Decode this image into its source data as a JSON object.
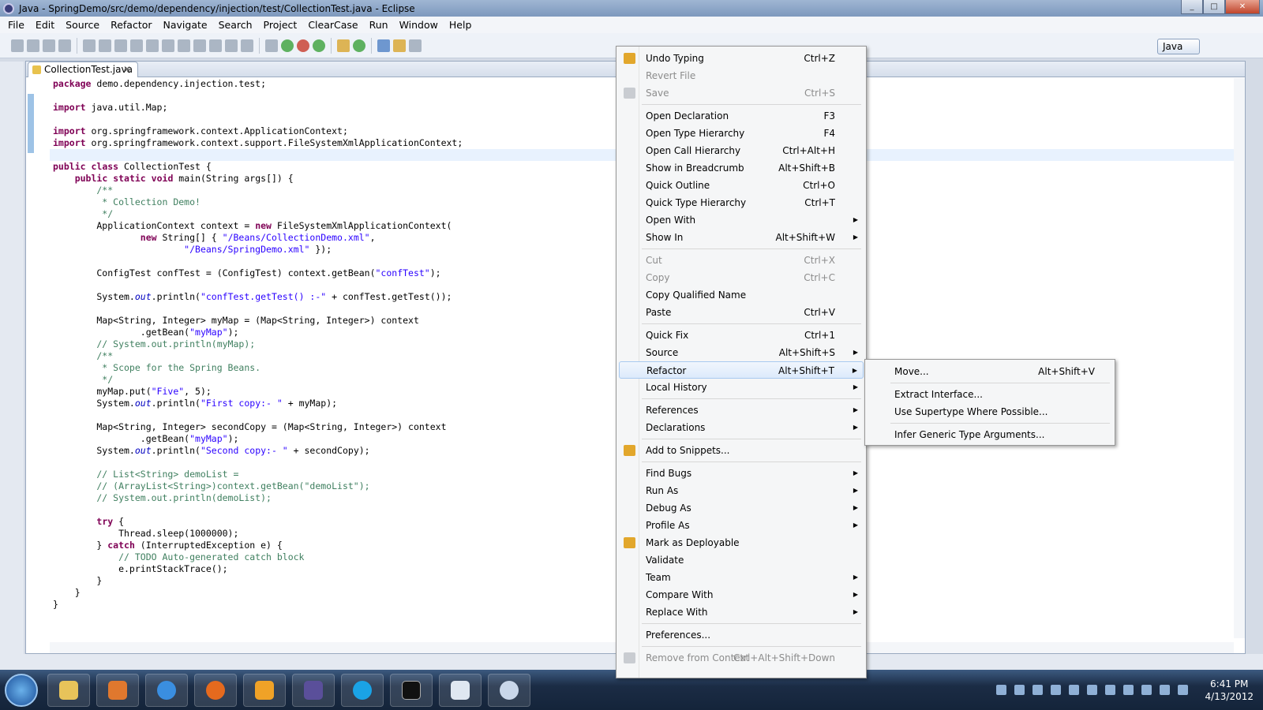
{
  "window": {
    "title": "Java - SpringDemo/src/demo/dependency/injection/test/CollectionTest.java - Eclipse"
  },
  "menubar": [
    "File",
    "Edit",
    "Source",
    "Refactor",
    "Navigate",
    "Search",
    "Project",
    "ClearCase",
    "Run",
    "Window",
    "Help"
  ],
  "perspective": {
    "label": "Java"
  },
  "editor": {
    "tab_label": "CollectionTest.java",
    "code_lines": [
      "package demo.dependency.injection.test;",
      "",
      "import java.util.Map;",
      "",
      "import org.springframework.context.ApplicationContext;",
      "import org.springframework.context.support.FileSystemXmlApplicationContext;",
      "",
      "public class CollectionTest {",
      "    public static void main(String args[]) {",
      "        /**",
      "         * Collection Demo!",
      "         */",
      "        ApplicationContext context = new FileSystemXmlApplicationContext(",
      "                new String[] { \"/Beans/CollectionDemo.xml\",",
      "                        \"/Beans/SpringDemo.xml\" });",
      "",
      "        ConfigTest confTest = (ConfigTest) context.getBean(\"confTest\");",
      "",
      "        System.out.println(\"confTest.getTest() :-\" + confTest.getTest());",
      "",
      "        Map<String, Integer> myMap = (Map<String, Integer>) context",
      "                .getBean(\"myMap\");",
      "        // System.out.println(myMap);",
      "        /**",
      "         * Scope for the Spring Beans.",
      "         */",
      "        myMap.put(\"Five\", 5);",
      "        System.out.println(\"First copy:- \" + myMap);",
      "",
      "        Map<String, Integer> secondCopy = (Map<String, Integer>) context",
      "                .getBean(\"myMap\");",
      "        System.out.println(\"Second copy:- \" + secondCopy);",
      "",
      "        // List<String> demoList =",
      "        // (ArrayList<String>)context.getBean(\"demoList\");",
      "        // System.out.println(demoList);",
      "",
      "        try {",
      "            Thread.sleep(1000000);",
      "        } catch (InterruptedException e) {",
      "            // TODO Auto-generated catch block",
      "            e.printStackTrace();",
      "        }",
      "    }",
      "}"
    ]
  },
  "context_menu": [
    {
      "label": "Undo Typing",
      "shortcut": "Ctrl+Z",
      "icon": "undo-icon"
    },
    {
      "label": "Revert File",
      "disabled": true
    },
    {
      "label": "Save",
      "shortcut": "Ctrl+S",
      "disabled": true,
      "icon": "save-icon"
    },
    {
      "sep": true
    },
    {
      "label": "Open Declaration",
      "shortcut": "F3"
    },
    {
      "label": "Open Type Hierarchy",
      "shortcut": "F4"
    },
    {
      "label": "Open Call Hierarchy",
      "shortcut": "Ctrl+Alt+H"
    },
    {
      "label": "Show in Breadcrumb",
      "shortcut": "Alt+Shift+B"
    },
    {
      "label": "Quick Outline",
      "shortcut": "Ctrl+O"
    },
    {
      "label": "Quick Type Hierarchy",
      "shortcut": "Ctrl+T"
    },
    {
      "label": "Open With",
      "submenu": true
    },
    {
      "label": "Show In",
      "shortcut": "Alt+Shift+W",
      "submenu": true
    },
    {
      "sep": true
    },
    {
      "label": "Cut",
      "shortcut": "Ctrl+X",
      "disabled": true
    },
    {
      "label": "Copy",
      "shortcut": "Ctrl+C",
      "disabled": true
    },
    {
      "label": "Copy Qualified Name"
    },
    {
      "label": "Paste",
      "shortcut": "Ctrl+V"
    },
    {
      "sep": true
    },
    {
      "label": "Quick Fix",
      "shortcut": "Ctrl+1"
    },
    {
      "label": "Source",
      "shortcut": "Alt+Shift+S",
      "submenu": true
    },
    {
      "label": "Refactor",
      "shortcut": "Alt+Shift+T",
      "submenu": true,
      "highlighted": true
    },
    {
      "label": "Local History",
      "submenu": true
    },
    {
      "sep": true
    },
    {
      "label": "References",
      "submenu": true
    },
    {
      "label": "Declarations",
      "submenu": true
    },
    {
      "sep": true
    },
    {
      "label": "Add to Snippets...",
      "icon": "snippet-icon"
    },
    {
      "sep": true
    },
    {
      "label": "Find Bugs",
      "submenu": true
    },
    {
      "label": "Run As",
      "submenu": true
    },
    {
      "label": "Debug As",
      "submenu": true
    },
    {
      "label": "Profile As",
      "submenu": true
    },
    {
      "label": "Mark as Deployable",
      "icon": "deploy-icon"
    },
    {
      "label": "Validate"
    },
    {
      "label": "Team",
      "submenu": true
    },
    {
      "label": "Compare With",
      "submenu": true
    },
    {
      "label": "Replace With",
      "submenu": true
    },
    {
      "sep": true
    },
    {
      "label": "Preferences..."
    },
    {
      "sep": true
    },
    {
      "label": "Remove from Context",
      "shortcut": "Ctrl+Alt+Shift+Down",
      "disabled": true,
      "icon": "remove-context-icon"
    }
  ],
  "submenu": [
    {
      "label": "Move...",
      "shortcut": "Alt+Shift+V"
    },
    {
      "sep": true
    },
    {
      "label": "Extract Interface..."
    },
    {
      "label": "Use Supertype Where Possible..."
    },
    {
      "sep": true
    },
    {
      "label": "Infer Generic Type Arguments..."
    }
  ],
  "clock": {
    "time": "6:41 PM",
    "date": "4/13/2012"
  }
}
